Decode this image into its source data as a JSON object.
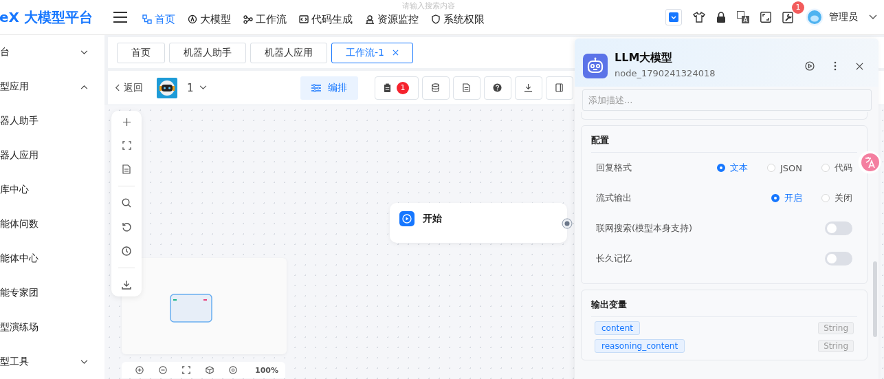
{
  "header": {
    "logo": "eX 大模型平台",
    "nav": [
      {
        "label": "首页",
        "selected": true
      },
      {
        "label": "大模型",
        "selected": false
      },
      {
        "label": "工作流",
        "selected": false
      },
      {
        "label": "代码生成",
        "selected": false
      },
      {
        "label": "资源监控",
        "selected": false
      },
      {
        "label": "系统权限",
        "selected": false
      }
    ],
    "search": {
      "placeholder": "请输入搜索内容"
    },
    "notification_count": "1",
    "user": "管理员"
  },
  "sidebar": {
    "items": [
      {
        "label": "台",
        "kind": "group",
        "expanded": false
      },
      {
        "label": "型应用",
        "kind": "group",
        "expanded": true
      },
      {
        "label": "器人助手",
        "kind": "item"
      },
      {
        "label": "器人应用",
        "kind": "item"
      },
      {
        "label": "库中心",
        "kind": "item"
      },
      {
        "label": "能体问数",
        "kind": "item"
      },
      {
        "label": "能体中心",
        "kind": "item"
      },
      {
        "label": "能专家团",
        "kind": "item"
      },
      {
        "label": "型演练场",
        "kind": "item"
      },
      {
        "label": "型工具",
        "kind": "group",
        "expanded": false
      }
    ]
  },
  "tabs": [
    {
      "label": "首页",
      "selected": false
    },
    {
      "label": "机器人助手",
      "selected": false
    },
    {
      "label": "机器人应用",
      "selected": false
    },
    {
      "label": "工作流-1",
      "selected": true
    }
  ],
  "toolbar": {
    "back": "返回",
    "version": "1",
    "arrange": "编排",
    "badge": "1"
  },
  "canvas": {
    "node": {
      "title": "开始"
    },
    "zoom": "100%"
  },
  "panel": {
    "title": "LLM大模型",
    "node_id": "node_1790241324018",
    "description": {
      "placeholder": "添加描述..."
    },
    "config": {
      "title": "配置",
      "rows": [
        {
          "kind": "radio",
          "label": "回复格式",
          "options": [
            {
              "label": "文本",
              "selected": true
            },
            {
              "label": "JSON",
              "selected": false
            },
            {
              "label": "代码",
              "selected": false
            }
          ]
        },
        {
          "kind": "radio",
          "label": "流式输出",
          "options": [
            {
              "label": "开启",
              "selected": true
            },
            {
              "label": "关闭",
              "selected": false
            }
          ]
        },
        {
          "kind": "switch",
          "label": "联网搜索(模型本身支持)",
          "on": false
        },
        {
          "kind": "switch",
          "label": "长久记忆",
          "on": false
        }
      ]
    },
    "outputs": {
      "title": "输出变量",
      "variables": [
        {
          "name": "content",
          "type": "String"
        },
        {
          "name": "reasoning_content",
          "type": "String"
        }
      ]
    }
  }
}
